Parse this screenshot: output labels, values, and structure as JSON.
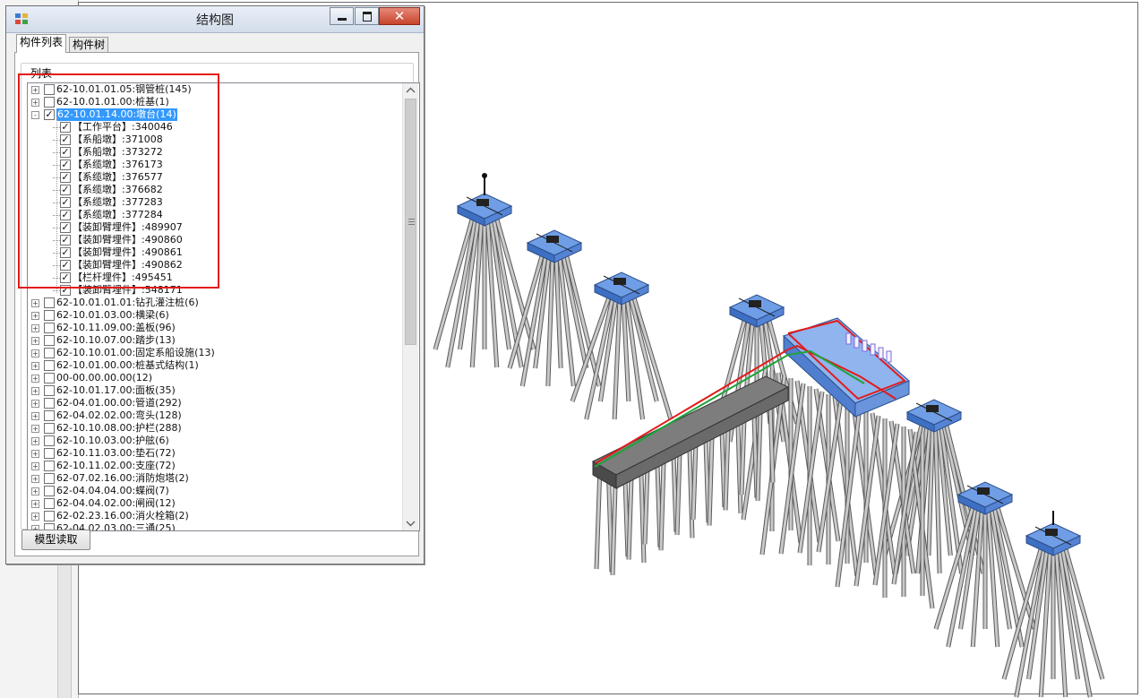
{
  "window": {
    "title": "结构图"
  },
  "tabs": [
    {
      "label": "构件列表"
    },
    {
      "label": "构件树"
    }
  ],
  "group": {
    "label": "列表"
  },
  "tree": {
    "items": [
      {
        "label": "62-10.01.01.05:钢管桩(145)",
        "level": 0,
        "expander": "+",
        "checked": false,
        "selected": false
      },
      {
        "label": "62-10.01.01.00:桩基(1)",
        "level": 0,
        "expander": "+",
        "checked": false,
        "selected": false
      },
      {
        "label": "62-10.01.14.00:墩台(14)",
        "level": 0,
        "expander": "-",
        "checked": true,
        "selected": true
      },
      {
        "label": "【工作平台】:340046",
        "level": 1,
        "expander": "",
        "checked": true,
        "selected": false
      },
      {
        "label": "【系船墩】:371008",
        "level": 1,
        "expander": "",
        "checked": true,
        "selected": false
      },
      {
        "label": "【系船墩】:373272",
        "level": 1,
        "expander": "",
        "checked": true,
        "selected": false
      },
      {
        "label": "【系缆墩】:376173",
        "level": 1,
        "expander": "",
        "checked": true,
        "selected": false
      },
      {
        "label": "【系缆墩】:376577",
        "level": 1,
        "expander": "",
        "checked": true,
        "selected": false
      },
      {
        "label": "【系缆墩】:376682",
        "level": 1,
        "expander": "",
        "checked": true,
        "selected": false
      },
      {
        "label": "【系缆墩】:377283",
        "level": 1,
        "expander": "",
        "checked": true,
        "selected": false
      },
      {
        "label": "【系缆墩】:377284",
        "level": 1,
        "expander": "",
        "checked": true,
        "selected": false
      },
      {
        "label": "【装卸臂埋件】:489907",
        "level": 1,
        "expander": "",
        "checked": true,
        "selected": false
      },
      {
        "label": "【装卸臂埋件】:490860",
        "level": 1,
        "expander": "",
        "checked": true,
        "selected": false
      },
      {
        "label": "【装卸臂埋件】:490861",
        "level": 1,
        "expander": "",
        "checked": true,
        "selected": false
      },
      {
        "label": "【装卸臂埋件】:490862",
        "level": 1,
        "expander": "",
        "checked": true,
        "selected": false
      },
      {
        "label": "【栏杆埋件】:495451",
        "level": 1,
        "expander": "",
        "checked": true,
        "selected": false
      },
      {
        "label": "【装卸臂埋件】:548171",
        "level": 1,
        "expander": "",
        "checked": true,
        "selected": false
      },
      {
        "label": "62-10.01.01.01:钻孔灌注桩(6)",
        "level": 0,
        "expander": "+",
        "checked": false,
        "selected": false
      },
      {
        "label": "62-10.01.03.00:横梁(6)",
        "level": 0,
        "expander": "+",
        "checked": false,
        "selected": false
      },
      {
        "label": "62-10.11.09.00:盖板(96)",
        "level": 0,
        "expander": "+",
        "checked": false,
        "selected": false
      },
      {
        "label": "62-10.10.07.00:踏步(13)",
        "level": 0,
        "expander": "+",
        "checked": false,
        "selected": false
      },
      {
        "label": "62-10.10.01.00:固定系船设施(13)",
        "level": 0,
        "expander": "+",
        "checked": false,
        "selected": false
      },
      {
        "label": "62-10.01.00.00:桩基式结构(1)",
        "level": 0,
        "expander": "+",
        "checked": false,
        "selected": false
      },
      {
        "label": "00-00.00.00.00(12)",
        "level": 0,
        "expander": "+",
        "checked": false,
        "selected": false
      },
      {
        "label": "62-10.01.17.00:面板(35)",
        "level": 0,
        "expander": "+",
        "checked": false,
        "selected": false
      },
      {
        "label": "62-04.01.00.00:管道(292)",
        "level": 0,
        "expander": "+",
        "checked": false,
        "selected": false
      },
      {
        "label": "62-04.02.02.00:弯头(128)",
        "level": 0,
        "expander": "+",
        "checked": false,
        "selected": false
      },
      {
        "label": "62-10.10.08.00:护栏(288)",
        "level": 0,
        "expander": "+",
        "checked": false,
        "selected": false
      },
      {
        "label": "62-10.10.03.00:护舷(6)",
        "level": 0,
        "expander": "+",
        "checked": false,
        "selected": false
      },
      {
        "label": "62-10.11.03.00:垫石(72)",
        "level": 0,
        "expander": "+",
        "checked": false,
        "selected": false
      },
      {
        "label": "62-10.11.02.00:支座(72)",
        "level": 0,
        "expander": "+",
        "checked": false,
        "selected": false
      },
      {
        "label": "62-07.02.16.00:消防炮塔(2)",
        "level": 0,
        "expander": "+",
        "checked": false,
        "selected": false
      },
      {
        "label": "62-04.04.04.00:蝶阀(7)",
        "level": 0,
        "expander": "+",
        "checked": false,
        "selected": false
      },
      {
        "label": "62-04.04.02.00:闸阀(12)",
        "level": 0,
        "expander": "+",
        "checked": false,
        "selected": false
      },
      {
        "label": "62-02.23.16.00:消火栓箱(2)",
        "level": 0,
        "expander": "+",
        "checked": false,
        "selected": false
      },
      {
        "label": "62-04.02.03.00:三通(25)",
        "level": 0,
        "expander": "+",
        "checked": false,
        "selected": false
      }
    ]
  },
  "buttons": {
    "load_model": "模型读取"
  },
  "colors": {
    "highlight_box": "#e21b1b",
    "selection": "#3399ff",
    "platform_blue": "#6f9ee6"
  }
}
